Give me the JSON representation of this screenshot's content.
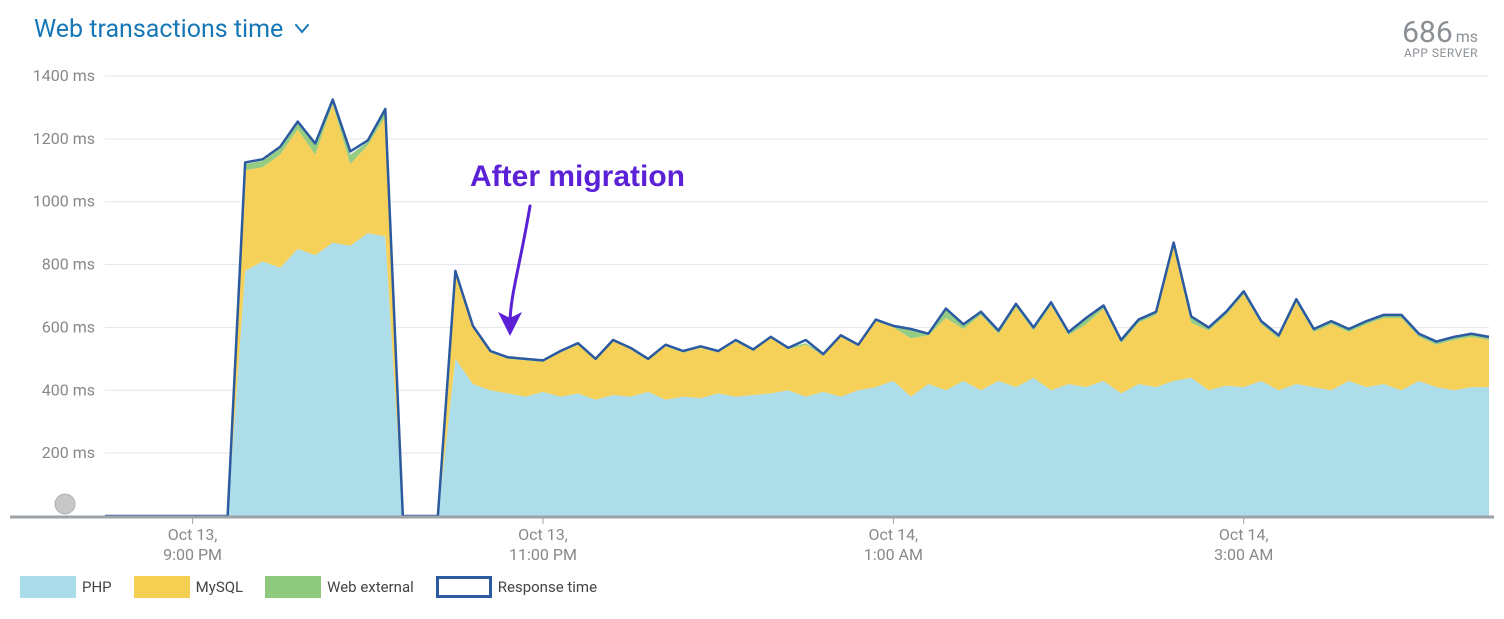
{
  "header": {
    "title": "Web transactions time",
    "metric_value": "686",
    "metric_unit": "ms",
    "metric_label": "APP SERVER"
  },
  "annotation": {
    "text": "After migration"
  },
  "legend": [
    {
      "name": "PHP",
      "fill": "#a9dbe8",
      "stroke": "none"
    },
    {
      "name": "MySQL",
      "fill": "#f5cf51",
      "stroke": "none"
    },
    {
      "name": "Web external",
      "fill": "#8fc97d",
      "stroke": "none"
    },
    {
      "name": "Response time",
      "fill": "#ffffff",
      "stroke": "#2c5aa0"
    }
  ],
  "chart_data": {
    "type": "area",
    "title": "Web transactions time",
    "xlabel": "",
    "ylabel": "",
    "y_unit": "ms",
    "ylim": [
      0,
      1400
    ],
    "y_ticks": [
      200,
      400,
      600,
      800,
      1000,
      1200,
      1400
    ],
    "x_ticks": [
      {
        "index": 5,
        "line1": "Oct 13,",
        "line2": "9:00 PM"
      },
      {
        "index": 25,
        "line1": "Oct 13,",
        "line2": "11:00 PM"
      },
      {
        "index": 45,
        "line1": "Oct 14,",
        "line2": "1:00 AM"
      },
      {
        "index": 65,
        "line1": "Oct 14,",
        "line2": "3:00 AM"
      }
    ],
    "n_points": 80,
    "series": [
      {
        "name": "PHP",
        "color": "#a9dbe8",
        "values": [
          0,
          0,
          0,
          0,
          0,
          0,
          0,
          0,
          780,
          810,
          790,
          850,
          830,
          870,
          860,
          900,
          890,
          0,
          0,
          0,
          500,
          420,
          400,
          390,
          380,
          395,
          380,
          390,
          370,
          385,
          380,
          395,
          370,
          380,
          375,
          390,
          380,
          385,
          390,
          400,
          380,
          395,
          380,
          400,
          410,
          430,
          380,
          420,
          400,
          430,
          400,
          430,
          410,
          440,
          400,
          420,
          410,
          430,
          390,
          420,
          410,
          430,
          440,
          400,
          415,
          410,
          430,
          400,
          420,
          410,
          400,
          430,
          410,
          420,
          400,
          430,
          410,
          400,
          410,
          410
        ]
      },
      {
        "name": "MySQL",
        "color": "#f5cf51",
        "values": [
          0,
          0,
          0,
          0,
          0,
          0,
          0,
          0,
          320,
          300,
          360,
          380,
          320,
          440,
          260,
          280,
          380,
          0,
          0,
          0,
          270,
          180,
          120,
          110,
          115,
          95,
          140,
          155,
          130,
          175,
          150,
          100,
          170,
          140,
          160,
          130,
          175,
          140,
          180,
          130,
          165,
          115,
          190,
          140,
          210,
          170,
          185,
          155,
          230,
          165,
          240,
          150,
          255,
          150,
          270,
          155,
          200,
          230,
          160,
          195,
          230,
          430,
          175,
          190,
          225,
          295,
          180,
          165,
          260,
          175,
          210,
          155,
          200,
          210,
          230,
          140,
          135,
          160,
          160,
          150
        ]
      },
      {
        "name": "Web external",
        "color": "#8fc97d",
        "values": [
          0,
          0,
          0,
          0,
          0,
          0,
          0,
          0,
          20,
          20,
          20,
          20,
          30,
          10,
          30,
          10,
          20,
          0,
          0,
          0,
          10,
          5,
          5,
          5,
          5,
          5,
          5,
          5,
          5,
          5,
          5,
          5,
          5,
          5,
          5,
          5,
          5,
          5,
          5,
          5,
          5,
          5,
          5,
          5,
          5,
          5,
          30,
          5,
          30,
          15,
          10,
          10,
          10,
          10,
          10,
          10,
          20,
          10,
          10,
          10,
          10,
          10,
          20,
          10,
          10,
          10,
          10,
          10,
          10,
          10,
          10,
          10,
          10,
          10,
          10,
          10,
          10,
          10,
          10,
          10
        ]
      }
    ],
    "response_time": [
      0,
      0,
      0,
      0,
      0,
      0,
      0,
      0,
      1125,
      1135,
      1175,
      1255,
      1185,
      1325,
      1160,
      1195,
      1295,
      0,
      0,
      0,
      780,
      605,
      525,
      505,
      500,
      495,
      525,
      550,
      500,
      560,
      535,
      500,
      545,
      525,
      540,
      525,
      560,
      530,
      570,
      535,
      560,
      515,
      575,
      545,
      625,
      605,
      595,
      580,
      660,
      610,
      650,
      590,
      675,
      600,
      680,
      585,
      630,
      670,
      560,
      625,
      650,
      870,
      635,
      600,
      650,
      715,
      620,
      575,
      690,
      595,
      620,
      595,
      620,
      640,
      640,
      580,
      555,
      570,
      580,
      570
    ]
  }
}
